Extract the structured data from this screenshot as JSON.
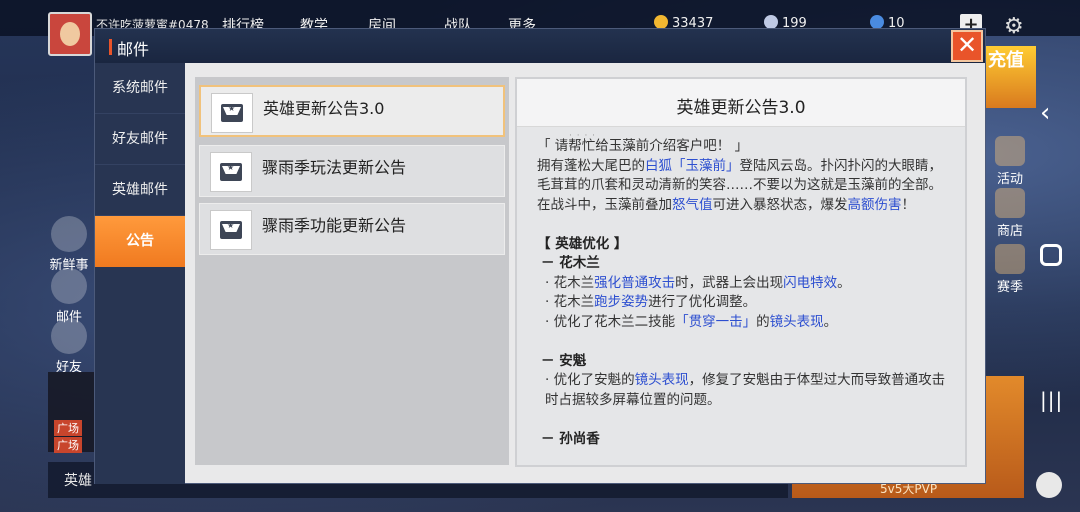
{
  "colors": {
    "accent": "#f07a20",
    "close": "#e9542a",
    "link": "#2d4fd0",
    "header": "#1a2640"
  },
  "game_bg": {
    "player_name": "不许吃菠萝蜜#0478",
    "top_nav": [
      "排行榜",
      "教学",
      "房间",
      "战队",
      "更多"
    ],
    "coins": "33437",
    "diamonds": "199",
    "tickets": "10",
    "left_icons": [
      "新鲜事",
      "邮件",
      "好友"
    ],
    "chat_tags": [
      "广场",
      "广场"
    ],
    "bottom_label": "英雄",
    "promo_text": "充值",
    "right_icons": [
      "活动",
      "商店",
      "赛季"
    ],
    "pvp_label": "5v5大PVP"
  },
  "dialog": {
    "title": "邮件",
    "close_label": "✕",
    "tabs": [
      {
        "label": "系统邮件"
      },
      {
        "label": "好友邮件"
      },
      {
        "label": "英雄邮件"
      },
      {
        "label": "公告",
        "active": true
      }
    ],
    "mails": [
      {
        "title": "英雄更新公告3.0",
        "selected": true,
        "icon": "inbox-icon"
      },
      {
        "title": "骤雨季玩法更新公告",
        "icon": "inbox-icon"
      },
      {
        "title": "骤雨季功能更新公告",
        "icon": "inbox-icon"
      }
    ],
    "detail": {
      "title": "英雄更新公告3.0",
      "intro_quote": "「 请帮忙给玉藻前介绍客户吧！ 」",
      "intro_p1_a": "拥有蓬松大尾巴的",
      "intro_p1_hl1": "白狐「玉藻前」",
      "intro_p1_b": "登陆风云岛。扑闪扑闪的大眼睛，毛茸茸的爪套和灵动清新的笑容……不要以为这就是玉藻前的全部。在战斗中，玉藻前叠加",
      "intro_p1_hl2": "怒气值",
      "intro_p1_c": "可进入暴怒状态，爆发",
      "intro_p1_hl3": "高额伤害",
      "intro_p1_d": "！",
      "section1": "【 英雄优化 】",
      "hero1": "－ 花木兰",
      "h1b1_a": "·  花木兰",
      "h1b1_hl1": "强化普通攻击",
      "h1b1_b": "时，武器上会出现",
      "h1b1_hl2": "闪电特效",
      "h1b1_c": "。",
      "h1b2_a": "·  花木兰",
      "h1b2_hl": "跑步姿势",
      "h1b2_b": "进行了优化调整。",
      "h1b3_a": "·  优化了花木兰二技能",
      "h1b3_hl1": "「贯穿一击」",
      "h1b3_b": "的",
      "h1b3_hl2": "镜头表现",
      "h1b3_c": "。",
      "hero2": "－ 安魁",
      "h2b1_a": "·  优化了安魁的",
      "h2b1_hl": "镜头表现",
      "h2b1_b": "，修复了安魁由于体型过大而导致普通攻击时占据较多屏幕位置的问题。",
      "hero3": "－ 孙尚香"
    }
  }
}
